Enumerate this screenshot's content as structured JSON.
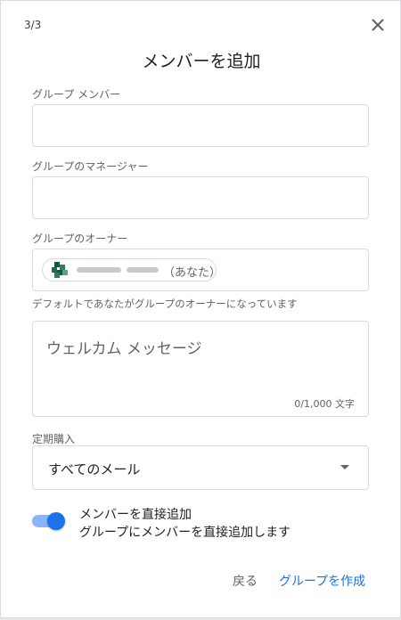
{
  "step": "3/3",
  "title": "メンバーを追加",
  "members": {
    "label": "グループ メンバー",
    "value": ""
  },
  "managers": {
    "label": "グループのマネージャー",
    "value": ""
  },
  "owners": {
    "label": "グループのオーナー",
    "chip_suffix": "（あなた）",
    "helper": "デフォルトであなたがグループのオーナーになっています"
  },
  "welcome": {
    "placeholder": "ウェルカム メッセージ",
    "counter": "0/1,000 文字"
  },
  "subscription": {
    "label": "定期購入",
    "selected": "すべてのメール"
  },
  "direct_add": {
    "enabled": true,
    "title": "メンバーを直接追加",
    "description": "グループにメンバーを直接追加します"
  },
  "actions": {
    "back": "戻る",
    "create": "グループを作成"
  },
  "colors": {
    "accent": "#1a73e8",
    "toggle_track": "#8ab4f8"
  },
  "icons": {
    "close": "close-icon",
    "dropdown": "chevron-down-icon",
    "avatar": "user-avatar"
  }
}
